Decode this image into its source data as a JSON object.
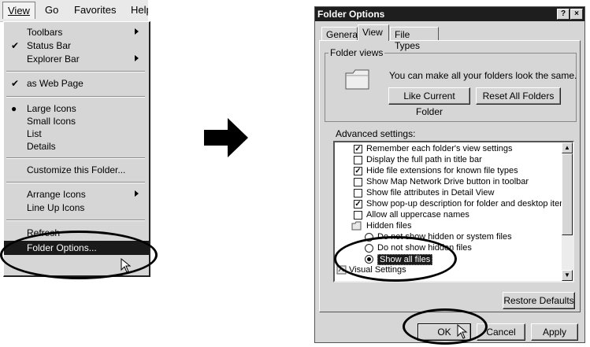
{
  "menubar": {
    "view": "View",
    "go": "Go",
    "favorites": "Favorites",
    "help": "Help"
  },
  "view_menu": {
    "toolbars": "Toolbars",
    "status_bar": "Status Bar",
    "explorer_bar": "Explorer Bar",
    "as_web_page": "as Web Page",
    "large_icons": "Large Icons",
    "small_icons": "Small Icons",
    "list": "List",
    "details": "Details",
    "customize": "Customize this Folder...",
    "arrange_icons": "Arrange Icons",
    "line_up_icons": "Line Up Icons",
    "refresh": "Refresh",
    "folder_options": "Folder Options...",
    "check": "✔",
    "bullet": "●"
  },
  "dialog": {
    "title": "Folder Options",
    "help_btn": "?",
    "close_btn": "×",
    "tabs": [
      "General",
      "View",
      "File Types"
    ],
    "group_label": "Folder views",
    "group_text": "You can make all your folders look the same.",
    "like_current": "Like Current Folder",
    "reset_all": "Reset All Folders",
    "advanced_label": "Advanced settings:",
    "items": [
      {
        "label": "Remember each folder's view settings",
        "kind": "check",
        "checked": true
      },
      {
        "label": "Display the full path in title bar",
        "kind": "check",
        "checked": false
      },
      {
        "label": "Hide file extensions for known file types",
        "kind": "check",
        "checked": true
      },
      {
        "label": "Show Map Network Drive button in toolbar",
        "kind": "check",
        "checked": false
      },
      {
        "label": "Show file attributes in Detail View",
        "kind": "check",
        "checked": false
      },
      {
        "label": "Show pop-up description for folder and desktop items.",
        "kind": "check",
        "checked": true
      },
      {
        "label": "Allow all uppercase names",
        "kind": "check",
        "checked": false
      },
      {
        "label": "Hidden files",
        "kind": "folder"
      },
      {
        "label": "Do not show hidden or system files",
        "kind": "radio",
        "checked": false
      },
      {
        "label": "Do not show hidden files",
        "kind": "radio",
        "checked": false
      },
      {
        "label": "Show all files",
        "kind": "radio",
        "checked": true
      },
      {
        "label": "Visual Settings",
        "kind": "folder2"
      }
    ],
    "check_mark": "✓",
    "restore_defaults": "Restore Defaults",
    "ok": "OK",
    "cancel": "Cancel",
    "apply": "Apply"
  }
}
